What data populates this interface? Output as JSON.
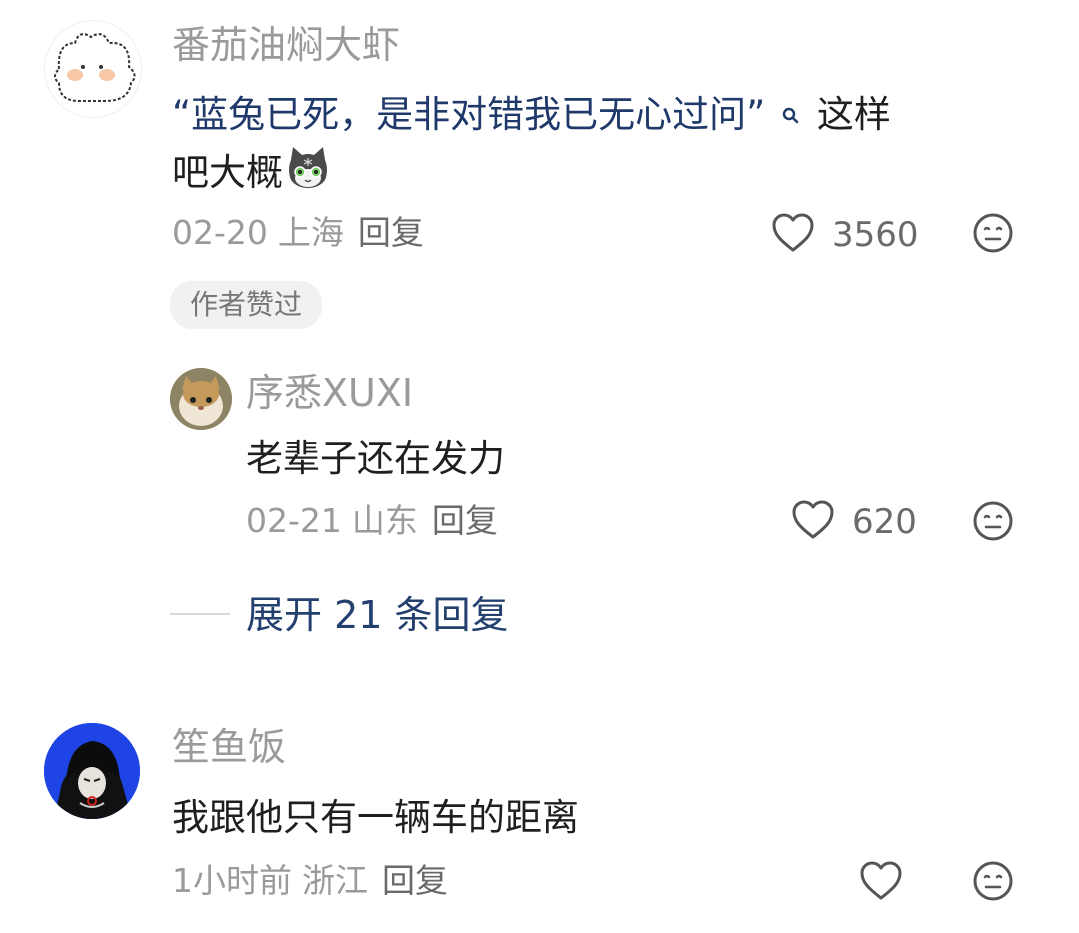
{
  "comments": [
    {
      "username": "番茄油焖大虾",
      "text_quote": "“蓝兔已死，是非对错我已无心过问”",
      "text_after": "这样",
      "text_line2": "吧大概",
      "date": "02-20",
      "location": "上海",
      "reply_label": "回复",
      "likes": "3560",
      "badge": "作者赞过",
      "avatar_icon": "white-cat-avatar",
      "emoji_icon": "cat-emoji-icon",
      "search_icon": "search-icon",
      "reply": {
        "username": "序悉XUXI",
        "text": "老辈子还在发力",
        "date": "02-21",
        "location": "山东",
        "reply_label": "回复",
        "likes": "620",
        "avatar_icon": "photo-cat-avatar"
      },
      "expand_label": "展开 21 条回复"
    },
    {
      "username": "笙鱼饭",
      "text": "我跟他只有一辆车的距离",
      "date": "1小时前",
      "location": "浙江",
      "reply_label": "回复",
      "avatar_icon": "anime-character-avatar"
    }
  ],
  "colors": {
    "link": "#1f3a6a",
    "expand": "#24406f",
    "muted": "#9a9a9a",
    "text": "#1f1f1f"
  }
}
